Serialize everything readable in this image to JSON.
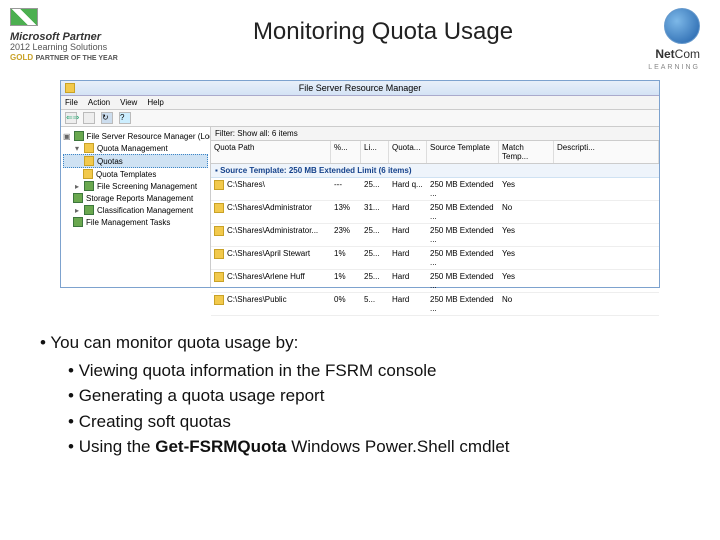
{
  "header": {
    "ms_partner": "Microsoft Partner",
    "ms_sub": "2012 Learning Solutions",
    "gold": "GOLD",
    "poty": "PARTNER OF THE YEAR",
    "title": "Monitoring Quota Usage",
    "netcom": "Net",
    "netcom2": "Com",
    "learning": "LEARNING"
  },
  "window": {
    "title": "File Server Resource Manager",
    "menu": [
      "File",
      "Action",
      "View",
      "Help"
    ],
    "tree": {
      "root": "File Server Resource Manager (Local)",
      "qm": "Quota Management",
      "quotas": "Quotas",
      "qt": "Quota Templates",
      "fsm": "File Screening Management",
      "srm": "Storage Reports Management",
      "cm": "Classification Management",
      "fmt": "File Management Tasks"
    },
    "filter_label": "Filter: Show all: 6 items",
    "columns": {
      "path": "Quota Path",
      "used": "%...",
      "limit": "Li...",
      "type": "Quota...",
      "template": "Source Template",
      "match": "Match Temp...",
      "desc": "Descripti..."
    },
    "group": "Source Template: 250 MB Extended Limit (6 items)",
    "rows": [
      {
        "path": "C:\\Shares\\",
        "used": "---",
        "limit": "25...",
        "type": "Hard q...",
        "template": "250 MB Extended ...",
        "match": "Yes"
      },
      {
        "path": "C:\\Shares\\Administrator",
        "used": "13%",
        "limit": "31...",
        "type": "Hard",
        "template": "250 MB Extended ...",
        "match": "No"
      },
      {
        "path": "C:\\Shares\\Administrator...",
        "used": "23%",
        "limit": "25...",
        "type": "Hard",
        "template": "250 MB Extended ...",
        "match": "Yes"
      },
      {
        "path": "C:\\Shares\\April Stewart",
        "used": "1%",
        "limit": "25...",
        "type": "Hard",
        "template": "250 MB Extended ...",
        "match": "Yes"
      },
      {
        "path": "C:\\Shares\\Arlene Huff",
        "used": "1%",
        "limit": "25...",
        "type": "Hard",
        "template": "250 MB Extended ...",
        "match": "Yes"
      },
      {
        "path": "C:\\Shares\\Public",
        "used": "0%",
        "limit": "5...",
        "type": "Hard",
        "template": "250 MB Extended ...",
        "match": "No"
      }
    ]
  },
  "bullets": {
    "lead": "You can monitor quota usage by:",
    "items": [
      "Viewing quota information in the FSRM console",
      "Generating a quota usage report",
      "Creating soft quotas"
    ],
    "last_prefix": "Using the ",
    "last_bold": "Get-FSRMQuota",
    "last_suffix": " Windows Power.Shell cmdlet"
  }
}
